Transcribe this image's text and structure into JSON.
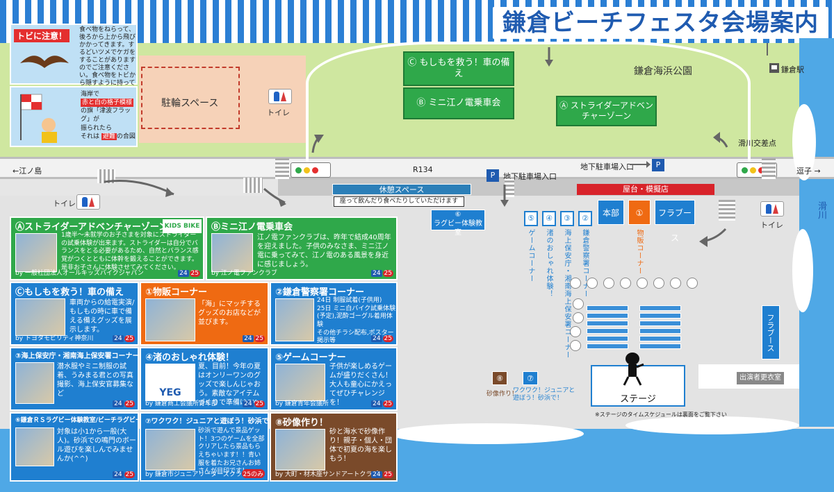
{
  "title": "鎌倉ビーチフェスタ会場案内",
  "warning": {
    "head": "トビに注意！",
    "text": "食べ物をねらって、後ろから上から飛びかかってきます。するどいツメでケガをすることがありますのでご注意ください。食べ物をトビから隠すように持って身を守ってください。"
  },
  "flag_notice": {
    "l1": "海岸で",
    "l2": "赤と白の格子模様",
    "l3": "の旗「津波フラッグ」",
    "l4": "が",
    "l5": "振られたら",
    "l6": "それは",
    "l7": "避難",
    "l8": "の合図"
  },
  "map": {
    "bike_parking": "駐輪スペース",
    "toilet": "トイレ",
    "park": "鎌倉海浜公園",
    "station": "鎌倉駅",
    "crossing": "滑川交差点",
    "enoshima": "←江ノ島",
    "zushi": "逗子 →",
    "road": "R134",
    "underground_left": "地下駐車場入口",
    "underground_right": "地下駐車場入口",
    "parking_p": "P",
    "river": "滑川",
    "rest_space": "休憩スペース",
    "rest_note": "座って飲んだり食べたりしていただけます",
    "stalls": "屋台・模擬店",
    "hq": "本部",
    "flabus": "フラブース",
    "stage": "ステージ",
    "stage_note": "※ステージのタイムスケジュールは裏面をご覧下さい",
    "dressing": "出演者更衣室",
    "zone_c": "Ⓒ もしもを救う！車の備え",
    "zone_b": "Ⓑ ミニ江ノ電乗車会",
    "zone_a": "Ⓐ ストライダーアドベンチャーゾーン",
    "rugby": "⑥\nラグビー体験教室",
    "booths": [
      {
        "num": "⑤",
        "label": "ゲームコーナー"
      },
      {
        "num": "④",
        "label": "渚のおしゃれ体験！"
      },
      {
        "num": "③",
        "label": "海上保安庁・湘南海上保安署コーナー"
      },
      {
        "num": "②",
        "label": "鎌倉警察署コーナー"
      },
      {
        "num": "①",
        "label": "物販コーナー"
      }
    ],
    "booth8_num": "⑧",
    "booth8_label": "砂像作り！",
    "booth7_num": "⑦",
    "booth7_label": "ワクワク！ジュニアと遊ぼう！砂浜で！"
  },
  "panels": {
    "a": {
      "title": "Ⓐストライダーアドベンチャーゾーン",
      "text": "1歳半～未就学のお子さまを対象にストライダーの試乗体験が出来ます。ストライダーは自分でバランスをとる必要があるため、自然とバランス感覚がつくとともに体幹を鍛えることができます。是非お子さんに体験させてみてください。",
      "by": "by 一般社団法人オールキッズバイクジャパン",
      "logo": "KIDS BIKE"
    },
    "b": {
      "title": "Ⓑミニ江ノ電乗車会",
      "text": "江ノ電ファンクラブは、昨年で結成40周年を迎えました。子供のみなさま、ミニ江ノ電に乗ってみて、江ノ電のある風景を身近に感じましょう。",
      "by": "by 江ノ電ファンクラブ"
    },
    "c": {
      "title": "Ⓒもしもを救う！車の備え",
      "text": "車両からの給電実演/もしもの時に車で備える備えグッズを展示します。",
      "by": "by トヨタモビリティ神奈川"
    },
    "p1": {
      "title": "①物販コーナー",
      "text": "「海」にマッチするグッズのお店などが並びます。"
    },
    "p2": {
      "title": "②鎌倉警察署コーナー",
      "text": "24日 制服試着(子供用)\n25日 ミニ白バイク試乗体験(予定),泥酔ゴーグル着用体験\nその他チラシ配布,ポスター掲示等"
    },
    "p3": {
      "title": "③海上保安庁・湘南海上保安署コーナー",
      "text": "潜水服やミニ制服の試着、うみまる君との写真撮影、海上保安官募集など"
    },
    "p4": {
      "title": "④渚のおしゃれ体験！",
      "text": "夏、目前！今年の夏はオンリーワンのグッズで楽しんじゃおう。素敵なアイテムづくりで準備はOK",
      "by": "by 鎌倉商工会議所青年部",
      "logo": "YEG"
    },
    "p5": {
      "title": "⑤ゲームコーナー",
      "text": "子供が楽しめるゲームが盛りだくさん！大人も童心にかえってぜひチャレンジを！",
      "by": "by 鎌倉青年会議所"
    },
    "p6": {
      "title": "⑥鎌倉ＲＳラグビー体験教室/ビーチラグビー大会",
      "text": "対象は小1から一般(大人)。砂浜での鳴門のボール遊びを楽しんでみませんか(^^)"
    },
    "p7": {
      "title": "⑦ワクワク！ジュニアと遊ぼう！砂浜で！",
      "text": "砂浜で遊んで景品ゲット！3つのゲームを全部クリアしたら景品もらえちゃいます！！青い服を着たお兄さんお姉さんが目印です！",
      "by": "by 鎌倉市ジュニアリーダーズクラブ",
      "only": "25のみ"
    },
    "p8": {
      "title": "⑧砂像作り！",
      "text": "砂と海水で砂像作り！親子・個人・団体で初夏の海を楽しもう！",
      "by": "by 大町・材木座サンドアートクラブ"
    },
    "day24": "24",
    "day25": "25"
  },
  "colors": {
    "blue": "#1f7fd0",
    "green": "#2fa84a",
    "orange": "#ef6a12",
    "brown": "#7a4a2a",
    "red": "#d8232a",
    "sea": "#4fa8e6"
  }
}
